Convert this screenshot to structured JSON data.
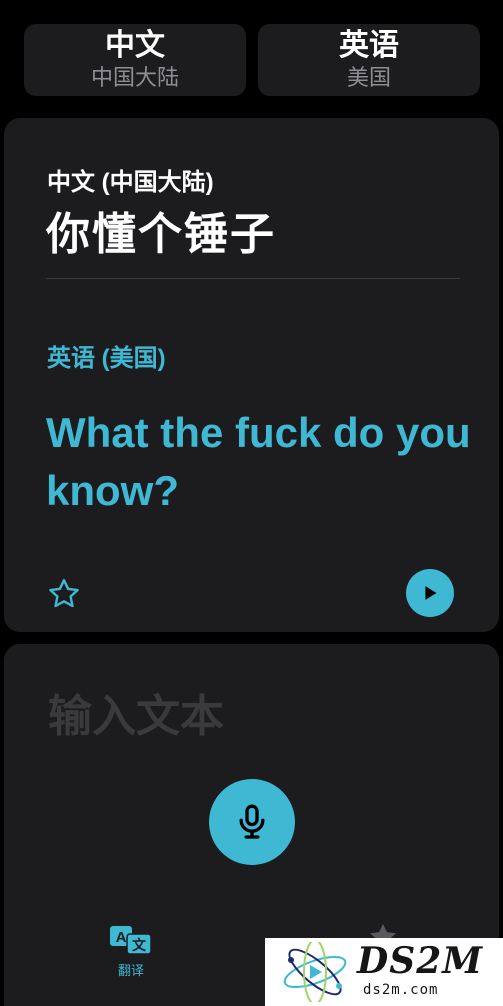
{
  "languages": {
    "source": {
      "name": "中文",
      "region": "中国大陆"
    },
    "target": {
      "name": "英语",
      "region": "美国"
    }
  },
  "translation": {
    "source_label": "中文 (中国大陆)",
    "source_text": "你懂个锤子",
    "target_label": "英语 (美国)",
    "target_text": "What the fuck do you know?",
    "favorite_icon": "star-outline",
    "play_icon": "play"
  },
  "input": {
    "placeholder": "输入文本",
    "mic_icon": "microphone"
  },
  "tabs": {
    "translate_label": "翻译",
    "translate_icon": "translate-a-wen",
    "favorites_icon": "star-filled"
  },
  "watermark": {
    "text": "DS2M",
    "url": "ds2m.com"
  },
  "colors": {
    "background": "#000000",
    "card": "#1c1c1e",
    "accent": "#3fb8d4",
    "secondary_text": "#8e8e93",
    "placeholder": "#3a3a3c"
  }
}
